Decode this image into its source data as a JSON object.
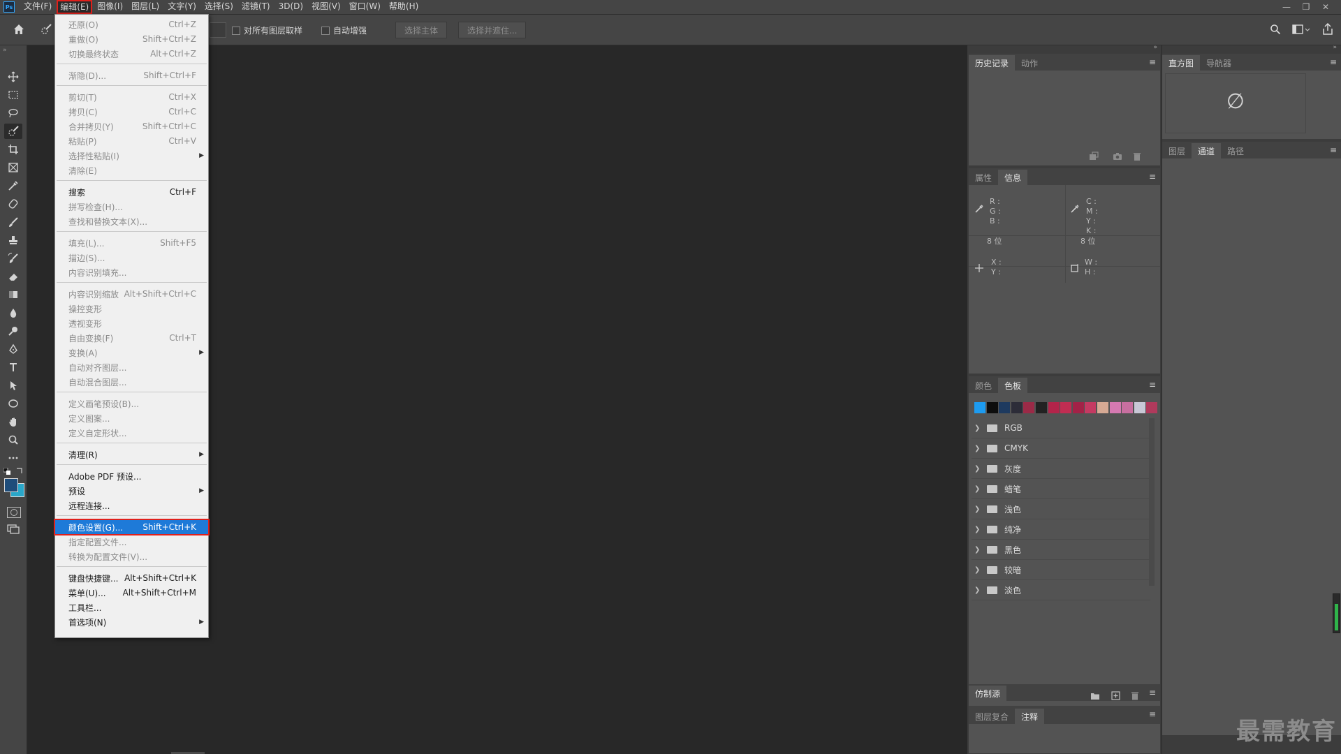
{
  "app": {
    "logo": "Ps"
  },
  "menubar": [
    {
      "label": "文件(F)"
    },
    {
      "label": "编辑(E)",
      "active": true
    },
    {
      "label": "图像(I)"
    },
    {
      "label": "图层(L)"
    },
    {
      "label": "文字(Y)"
    },
    {
      "label": "选择(S)"
    },
    {
      "label": "滤镜(T)"
    },
    {
      "label": "3D(D)"
    },
    {
      "label": "视图(V)"
    },
    {
      "label": "窗口(W)"
    },
    {
      "label": "帮助(H)"
    }
  ],
  "window_controls": {
    "minimize": "—",
    "restore": "❐",
    "close": "✕"
  },
  "options_bar": {
    "sample_all_layers": "对所有图层取样",
    "auto_enhance": "自动增强",
    "select_subject": "选择主体",
    "select_and_mask": "选择并遮住..."
  },
  "toolbar": {
    "tools": [
      "move-tool",
      "marquee-tool",
      "lasso-tool",
      "quick-selection-tool",
      "crop-tool",
      "frame-tool",
      "eyedropper-tool",
      "healing-brush-tool",
      "brush-tool",
      "clone-stamp-tool",
      "history-brush-tool",
      "eraser-tool",
      "gradient-tool",
      "blur-tool",
      "dodge-tool",
      "pen-tool",
      "type-tool",
      "path-selection-tool",
      "shape-tool",
      "hand-tool",
      "zoom-tool",
      "more-tools"
    ],
    "foreground_color": "#1f4d7a",
    "background_color": "#2aa7c9"
  },
  "edit_menu": {
    "items": [
      {
        "label": "还原(O)",
        "shortcut": "Ctrl+Z",
        "state": "disabled"
      },
      {
        "label": "重做(O)",
        "shortcut": "Shift+Ctrl+Z",
        "state": "disabled"
      },
      {
        "label": "切换最终状态",
        "shortcut": "Alt+Ctrl+Z",
        "state": "disabled"
      },
      {
        "label": "渐隐(D)...",
        "shortcut": "Shift+Ctrl+F",
        "state": "disabled"
      },
      {
        "label": "剪切(T)",
        "shortcut": "Ctrl+X",
        "state": "disabled"
      },
      {
        "label": "拷贝(C)",
        "shortcut": "Ctrl+C",
        "state": "disabled"
      },
      {
        "label": "合并拷贝(Y)",
        "shortcut": "Shift+Ctrl+C",
        "state": "disabled"
      },
      {
        "label": "粘贴(P)",
        "shortcut": "Ctrl+V",
        "state": "disabled"
      },
      {
        "label": "选择性粘贴(I)",
        "shortcut": "",
        "state": "disabled",
        "submenu": true
      },
      {
        "label": "清除(E)",
        "shortcut": "",
        "state": "disabled"
      },
      {
        "label": "搜索",
        "shortcut": "Ctrl+F",
        "state": "enabled"
      },
      {
        "label": "拼写检查(H)...",
        "shortcut": "",
        "state": "disabled"
      },
      {
        "label": "查找和替换文本(X)...",
        "shortcut": "",
        "state": "disabled"
      },
      {
        "label": "填充(L)...",
        "shortcut": "Shift+F5",
        "state": "disabled"
      },
      {
        "label": "描边(S)...",
        "shortcut": "",
        "state": "disabled"
      },
      {
        "label": "内容识别填充...",
        "shortcut": "",
        "state": "disabled"
      },
      {
        "label": "内容识别缩放",
        "shortcut": "Alt+Shift+Ctrl+C",
        "state": "disabled"
      },
      {
        "label": "操控变形",
        "shortcut": "",
        "state": "disabled"
      },
      {
        "label": "透视变形",
        "shortcut": "",
        "state": "disabled"
      },
      {
        "label": "自由变换(F)",
        "shortcut": "Ctrl+T",
        "state": "disabled"
      },
      {
        "label": "变换(A)",
        "shortcut": "",
        "state": "disabled",
        "submenu": true
      },
      {
        "label": "自动对齐图层...",
        "shortcut": "",
        "state": "disabled"
      },
      {
        "label": "自动混合图层...",
        "shortcut": "",
        "state": "disabled"
      },
      {
        "label": "定义画笔预设(B)...",
        "shortcut": "",
        "state": "disabled"
      },
      {
        "label": "定义图案...",
        "shortcut": "",
        "state": "disabled"
      },
      {
        "label": "定义自定形状...",
        "shortcut": "",
        "state": "disabled"
      },
      {
        "label": "清理(R)",
        "shortcut": "",
        "state": "enabled",
        "submenu": true
      },
      {
        "label": "Adobe PDF 预设...",
        "shortcut": "",
        "state": "enabled"
      },
      {
        "label": "预设",
        "shortcut": "",
        "state": "enabled",
        "submenu": true
      },
      {
        "label": "远程连接...",
        "shortcut": "",
        "state": "enabled"
      },
      {
        "label": "颜色设置(G)...",
        "shortcut": "Shift+Ctrl+K",
        "state": "highlighted"
      },
      {
        "label": "指定配置文件...",
        "shortcut": "",
        "state": "disabled"
      },
      {
        "label": "转换为配置文件(V)...",
        "shortcut": "",
        "state": "disabled"
      },
      {
        "label": "键盘快捷键...",
        "shortcut": "Alt+Shift+Ctrl+K",
        "state": "enabled"
      },
      {
        "label": "菜单(U)...",
        "shortcut": "Alt+Shift+Ctrl+M",
        "state": "enabled"
      },
      {
        "label": "工具栏...",
        "shortcut": "",
        "state": "enabled"
      },
      {
        "label": "首选项(N)",
        "shortcut": "",
        "state": "enabled",
        "submenu": true
      }
    ]
  },
  "panels": {
    "history": {
      "tabs": [
        "历史记录",
        "动作"
      ],
      "active": 0
    },
    "histogram": {
      "tabs": [
        "直方图",
        "导航器"
      ],
      "active": 0,
      "no_data_icon": "∅"
    },
    "layers": {
      "tabs": [
        "图层",
        "通道",
        "路径"
      ],
      "active": 1
    },
    "info": {
      "tabs": [
        "属性",
        "信息"
      ],
      "active": 1,
      "rgb_labels": "R :\nG :\nB :",
      "cmyk_labels": "C :\nM :\nY :\nK :",
      "bit_left": "8 位",
      "bit_right": "8 位",
      "xy_labels": "X :\nY :",
      "wh_labels": "W :\nH :"
    },
    "swatches": {
      "tabs": [
        "颜色",
        "色板"
      ],
      "active": 1,
      "colors": [
        "#1d9bf0",
        "#0d0d0d",
        "#1e3a5f",
        "#2c2c38",
        "#9b2a47",
        "#222222",
        "#b3244a",
        "#c02d52",
        "#a32247",
        "#c43a62",
        "#d6a994",
        "#d579b1",
        "#c86fa0",
        "#c8c8d6",
        "#b03a5c"
      ],
      "groups": [
        "RGB",
        "CMYK",
        "灰度",
        "蜡笔",
        "浅色",
        "纯净",
        "黑色",
        "较暗",
        "淡色"
      ]
    },
    "clone_source": {
      "tabs": [
        "仿制源"
      ],
      "active": 0
    },
    "layer_comps": {
      "tabs": [
        "图层复合",
        "注释"
      ],
      "active": 1
    }
  },
  "watermark": "最需教育"
}
